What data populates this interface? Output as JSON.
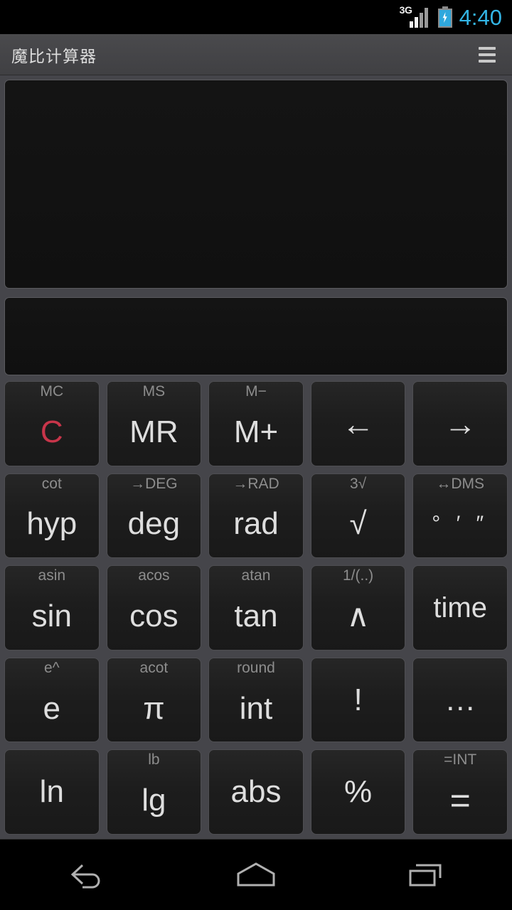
{
  "statusbar": {
    "network_label": "3G",
    "signal_icon": "signal-bars-icon",
    "battery_icon": "battery-charging-icon",
    "clock": "4:40",
    "accent_color": "#33b5e5"
  },
  "actionbar": {
    "title": "魔比计算器",
    "menu_icon": "hamburger-menu-icon"
  },
  "display": {
    "expression": "",
    "result": ""
  },
  "keypad": {
    "rows": [
      [
        {
          "sub": "MC",
          "main": "C",
          "style": "red",
          "name": "key-clear"
        },
        {
          "sub": "MS",
          "main": "MR",
          "style": "",
          "name": "key-memory-recall"
        },
        {
          "sub": "M−",
          "main": "M+",
          "style": "",
          "name": "key-memory-plus"
        },
        {
          "sub": "",
          "main": "←",
          "style": "arrow",
          "name": "key-cursor-left"
        },
        {
          "sub": "",
          "main": "→",
          "style": "arrow",
          "name": "key-cursor-right"
        }
      ],
      [
        {
          "sub": "cot",
          "main": "hyp",
          "style": "",
          "name": "key-hyp"
        },
        {
          "sub": "→DEG",
          "main": "deg",
          "style": "",
          "name": "key-deg"
        },
        {
          "sub": "→RAD",
          "main": "rad",
          "style": "",
          "name": "key-rad"
        },
        {
          "sub": "3√",
          "main": "√",
          "style": "",
          "name": "key-sqrt"
        },
        {
          "sub": "↔DMS",
          "main": "° ′ ″",
          "style": "dms",
          "name": "key-dms"
        }
      ],
      [
        {
          "sub": "asin",
          "main": "sin",
          "style": "",
          "name": "key-sin"
        },
        {
          "sub": "acos",
          "main": "cos",
          "style": "",
          "name": "key-cos"
        },
        {
          "sub": "atan",
          "main": "tan",
          "style": "",
          "name": "key-tan"
        },
        {
          "sub": "1/(..)",
          "main": "∧",
          "style": "",
          "name": "key-power"
        },
        {
          "sub": "",
          "main": "time",
          "style": "small",
          "name": "key-time"
        }
      ],
      [
        {
          "sub": "e^",
          "main": "e",
          "style": "",
          "name": "key-e"
        },
        {
          "sub": "acot",
          "main": "π",
          "style": "",
          "name": "key-pi"
        },
        {
          "sub": "round",
          "main": "int",
          "style": "",
          "name": "key-int"
        },
        {
          "sub": "",
          "main": "!",
          "style": "",
          "name": "key-factorial"
        },
        {
          "sub": "",
          "main": "…",
          "style": "",
          "name": "key-more"
        }
      ],
      [
        {
          "sub": "",
          "main": "ln",
          "style": "",
          "name": "key-ln"
        },
        {
          "sub": "lb",
          "main": "lg",
          "style": "",
          "name": "key-lg"
        },
        {
          "sub": "",
          "main": "abs",
          "style": "",
          "name": "key-abs"
        },
        {
          "sub": "",
          "main": "%",
          "style": "",
          "name": "key-percent"
        },
        {
          "sub": "=INT",
          "main": "=",
          "style": "eq",
          "name": "key-equals"
        }
      ]
    ]
  },
  "navbar": {
    "back_icon": "back-arrow-icon",
    "home_icon": "home-icon",
    "recents_icon": "recent-apps-icon"
  },
  "colors": {
    "background": "#45454a",
    "key_face": "#1d1d1d",
    "key_border": "#4e4e52",
    "text_primary": "#dedede",
    "text_secondary": "#8d8d8d",
    "clear_red": "#c8354a",
    "display_bg": "#111111"
  }
}
